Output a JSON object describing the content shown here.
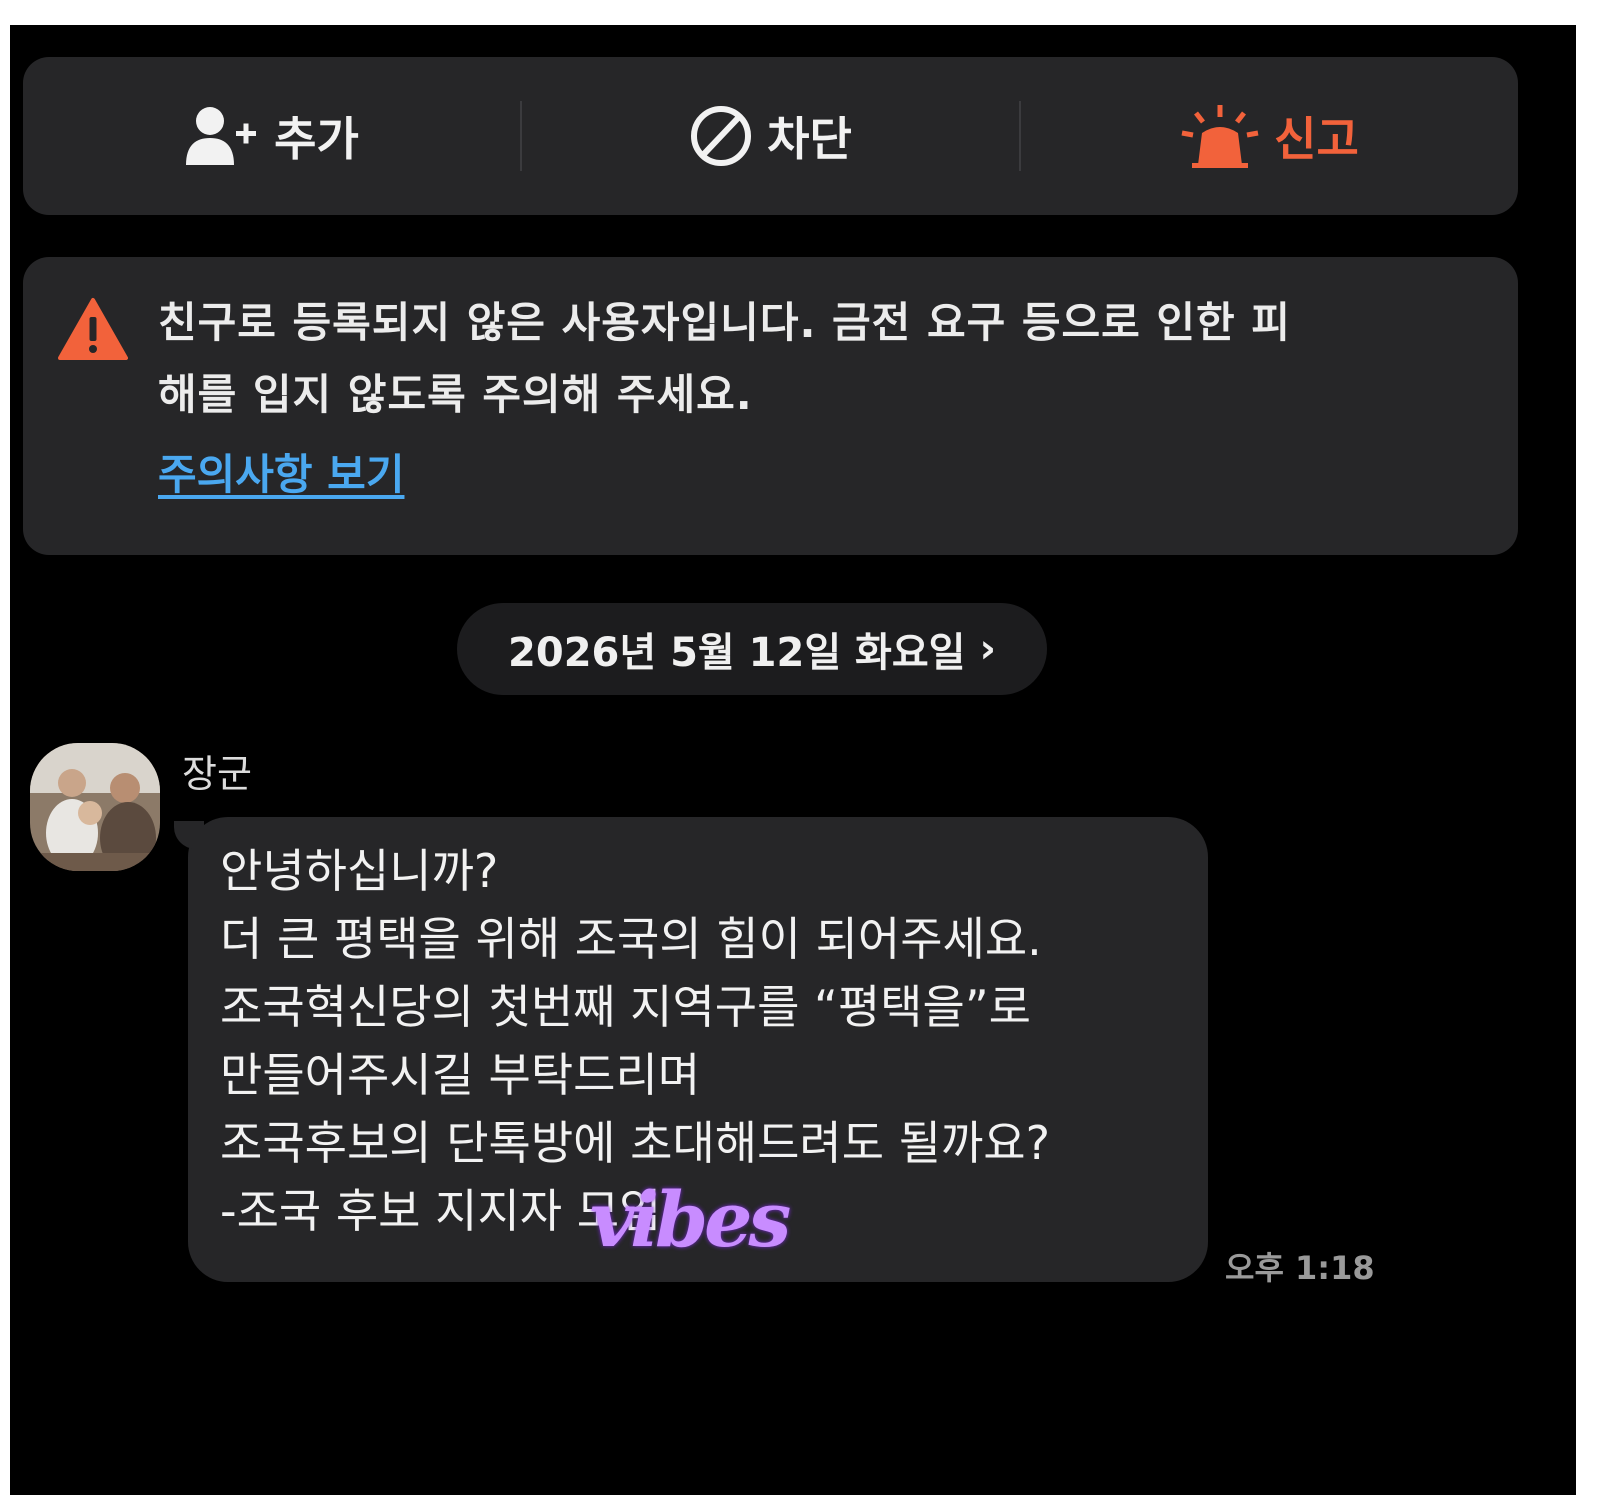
{
  "action_bar": {
    "add_label": "추가",
    "block_label": "차단",
    "report_label": "신고"
  },
  "warning": {
    "text_line1": "친구로 등록되지 않은 사용자입니다. 금전 요구 등으로 인한 피",
    "text_line2": "해를 입지 않도록 주의해 주세요.",
    "link_label": "주의사항 보기"
  },
  "date_chip": {
    "label": "2026년 5월 12일 화요일",
    "chevron": "›"
  },
  "message": {
    "sender_name": "장군",
    "lines": [
      "안녕하십니까?",
      "더 큰 평택을 위해 조국의 힘이 되어주세요.",
      "조국혁신당의 첫번째 지역구를 “평택을”로",
      "만들어주시길 부탁드리며",
      "조국후보의 단톡방에 초대해드려도 될까요?",
      "-조국 후보 지지자 모임-"
    ],
    "time": "오후 1:18",
    "watermark": "vibes"
  },
  "colors": {
    "background": "#000000",
    "panel": "#262628",
    "report_accent": "#f2623b",
    "link": "#4aa8f0"
  },
  "icons": {
    "add": "add-friend-icon",
    "block": "block-icon",
    "report": "siren-icon",
    "warning": "warning-triangle-icon"
  }
}
